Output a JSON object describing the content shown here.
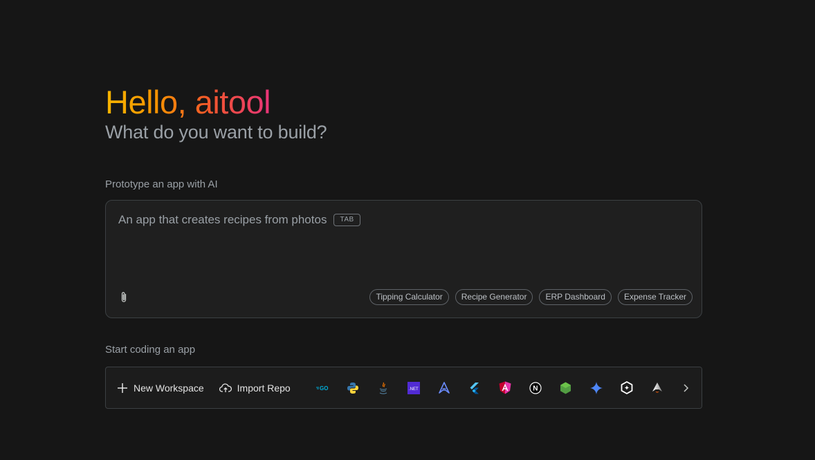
{
  "header": {
    "greeting": "Hello, aitool",
    "subtitle": "What do you want to build?"
  },
  "prototype": {
    "label": "Prototype an app with AI",
    "placeholder": "An app that creates recipes from photos",
    "tab_badge": "TAB",
    "suggestions": [
      "Tipping Calculator",
      "Recipe Generator",
      "ERP Dashboard",
      "Expense Tracker"
    ]
  },
  "coding": {
    "label": "Start coding an app",
    "new_workspace": "New Workspace",
    "import_repo": "Import Repo",
    "templates": [
      "go-icon",
      "python-icon",
      "java-icon",
      "dotnet-icon",
      "astro-icon",
      "flutter-icon",
      "angular-icon",
      "nextjs-icon",
      "nodejs-icon",
      "gemini-icon",
      "genkit-icon",
      "astro-alt-icon",
      "mongodb-icon"
    ],
    "net_text": ".NET",
    "go_text": "GO",
    "n_text": "N"
  }
}
